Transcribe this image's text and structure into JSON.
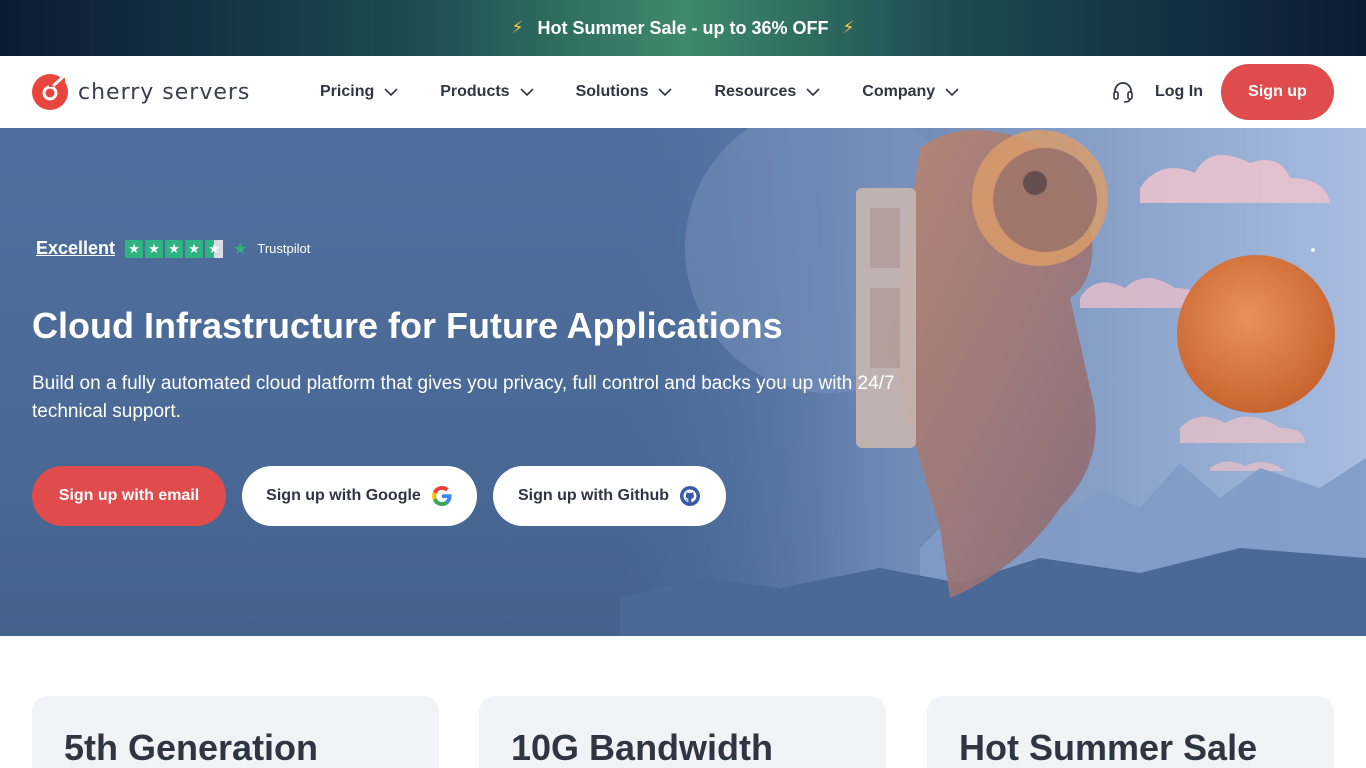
{
  "promo": {
    "text": "Hot Summer Sale - up to 36% OFF",
    "bolt_left": "⚡",
    "bolt_right": "⚡"
  },
  "header": {
    "logo_text": "cherry servers",
    "nav": [
      {
        "label": "Pricing"
      },
      {
        "label": "Products"
      },
      {
        "label": "Solutions"
      },
      {
        "label": "Resources"
      },
      {
        "label": "Company"
      }
    ],
    "login_label": "Log In",
    "signup_label": "Sign up"
  },
  "hero": {
    "trust_rating": "Excellent",
    "trust_stars": 4.5,
    "trust_brand": "Trustpilot",
    "title": "Cloud Infrastructure for Future Applications",
    "subtitle": "Build on a fully automated cloud platform that gives you privacy, full control and backs you up with 24/7 technical support.",
    "cta_email": "Sign up with email",
    "cta_google": "Sign up with Google",
    "cta_github": "Sign up with Github"
  },
  "cards": [
    {
      "title": "5th Generation"
    },
    {
      "title": "10G Bandwidth"
    },
    {
      "title": "Hot Summer Sale"
    }
  ],
  "colors": {
    "accent": "#e04b4b",
    "hero_bg": "#4a6996",
    "trustpilot_green": "#2fb380"
  }
}
